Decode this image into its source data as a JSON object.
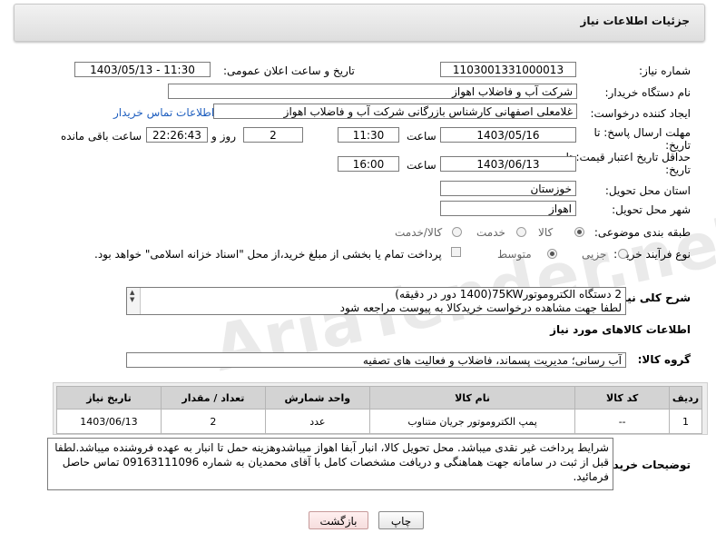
{
  "header": {
    "title": "جزئیات اطلاعات نیاز"
  },
  "form": {
    "need_number": {
      "label": "شماره نیاز:",
      "value": "1103001331000013"
    },
    "announce": {
      "label": "تاریخ و ساعت اعلان عمومی:",
      "value": "1403/05/13 - 11:30"
    },
    "buyer_org": {
      "label": "نام دستگاه خریدار:",
      "value": "شرکت آب و فاضلاب اهواز"
    },
    "requester": {
      "label": "ایجاد کننده درخواست:",
      "value": "غلامعلی اصفهانی کارشناس بازرگانی شرکت آب و فاضلاب اهواز",
      "contact_link": "اطلاعات تماس خریدار"
    },
    "deadline": {
      "label_line1": "مهلت ارسال پاسخ: تا",
      "label_line2": "تاریخ:",
      "date": "1403/05/16",
      "time_label": "ساعت",
      "time": "11:30",
      "days": "2",
      "days_label": "روز و",
      "remaining": "22:26:43",
      "remaining_label": "ساعت باقی مانده"
    },
    "validity": {
      "label_line1": "حداقل تاریخ اعتبار قیمت: تا",
      "label_line2": "تاریخ:",
      "date": "1403/06/13",
      "time_label": "ساعت",
      "time": "16:00"
    },
    "province": {
      "label": "استان محل تحویل:",
      "value": "خوزستان"
    },
    "city": {
      "label": "شهر محل تحویل:",
      "value": "اهواز"
    },
    "category": {
      "label": "طبقه بندی موضوعی:",
      "options": [
        "کالا",
        "خدمت",
        "کالا/خدمت"
      ],
      "selected": "کالا"
    },
    "process": {
      "label": "نوع فرآیند خرید :",
      "options": [
        "جزیی",
        "متوسط"
      ],
      "selected": "متوسط",
      "checkbox_text": "پرداخت تمام یا بخشی از مبلغ خرید،از محل \"اسناد خزانه اسلامی\" خواهد بود."
    }
  },
  "description": {
    "label": "شرح کلی نیاز:",
    "line1": "2 دستگاه الکتروموتور75KW(1400 دور در دقیقه)",
    "line2": "لطفا جهت مشاهده درخواست خریدکالا به پیوست مراجعه شود"
  },
  "goods_info": {
    "title": "اطلاعات کالاهای مورد نیاز",
    "group_label": "گروه کالا:",
    "group_value": "آب رسانی؛ مدیریت پسماند، فاضلاب و فعالیت های تصفیه"
  },
  "table": {
    "headers": [
      "ردیف",
      "کد کالا",
      "نام کالا",
      "واحد شمارش",
      "تعداد / مقدار",
      "تاریخ نیاز"
    ],
    "rows": [
      [
        "1",
        "--",
        "پمپ الکتروموتور جریان متناوب",
        "عدد",
        "2",
        "1403/06/13"
      ]
    ]
  },
  "buyer_notes": {
    "label": "توضیحات خریدار:",
    "line1": "شرایط پرداخت غیر نقدی میباشد. محل تحویل کالا، انبار آبفا اهواز میباشدوهزینه حمل تا انبار به عهده فروشنده میباشد.لطفا",
    "line2": "قبل از ثبت در سامانه جهت هماهنگی و دریافت مشخصات کامل با آقای  محمدیان به شماره 09163111096 تماس حاصل",
    "line3": "فرمائید."
  },
  "buttons": {
    "print": "چاپ",
    "back": "بازگشت"
  },
  "watermark": "AriaTender.neT"
}
